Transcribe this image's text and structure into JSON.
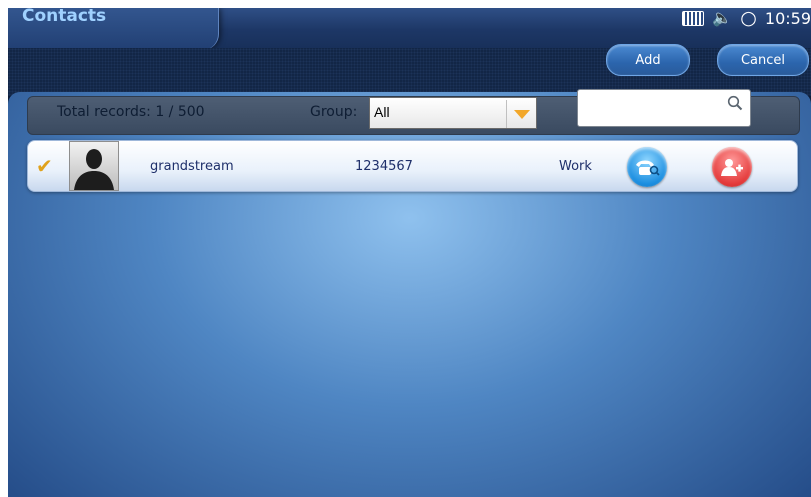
{
  "header": {
    "title": "Contacts",
    "clock": "10:59",
    "status_icons": [
      "keyboard-icon",
      "volume-icon",
      "sync-icon"
    ]
  },
  "actions": {
    "add_label": "Add",
    "cancel_label": "Cancel"
  },
  "filter": {
    "total_label": "Total records: 1 / 500",
    "group_label": "Group:",
    "group_value": "All",
    "search_placeholder": ""
  },
  "contacts": [
    {
      "name": "grandstream",
      "number": "1234567",
      "type": "Work",
      "selected": true
    }
  ],
  "colors": {
    "title": "#9fd1ff",
    "accent_blue": "#2b65ad",
    "dial_button": "#1b8ee0",
    "add_contact_button": "#e43a3a",
    "check": "#e0a21c"
  }
}
